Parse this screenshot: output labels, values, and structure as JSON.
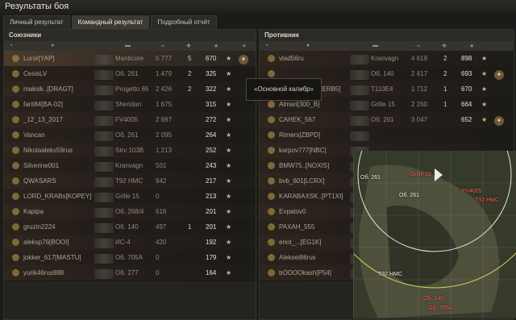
{
  "window": {
    "title": "Результаты боя"
  },
  "tabs": [
    {
      "label": "Личный результат",
      "active": false
    },
    {
      "label": "Командный результат",
      "active": true
    },
    {
      "label": "Подробный отчёт",
      "active": false
    }
  ],
  "allies": {
    "title": "Союзники",
    "rows": [
      {
        "player": "Luror[YAP]",
        "tank": "Manticore",
        "damage": "5 777",
        "kills": "5",
        "xp": "670"
      },
      {
        "player": "CesisLV",
        "tank": "Об. 261",
        "damage": "1 479",
        "kills": "2",
        "xp": "325"
      },
      {
        "player": "maksik..[DRAGT]",
        "tank": "Progetto 65",
        "damage": "2 426",
        "kills": "2",
        "xp": "322"
      },
      {
        "player": "farit84[BA-02]",
        "tank": "Sheridan",
        "damage": "1 675",
        "kills": "",
        "xp": "315"
      },
      {
        "player": "_12_13_2017",
        "tank": "FV4005",
        "damage": "2 697",
        "kills": "",
        "xp": "272"
      },
      {
        "player": "Vancan",
        "tank": "Об. 261",
        "damage": "2 095",
        "kills": "",
        "xp": "264"
      },
      {
        "player": "Nikolaaleks59rus",
        "tank": "Strv 103B",
        "damage": "1 213",
        "kills": "",
        "xp": "252"
      },
      {
        "player": "Silverine001",
        "tank": "Kranvagn",
        "damage": "501",
        "kills": "",
        "xp": "243"
      },
      {
        "player": "QWASARS",
        "tank": "T92 HMC",
        "damage": "942",
        "kills": "",
        "xp": "217"
      },
      {
        "player": "LORD_KRABs[KOPEY]",
        "tank": "Grille 15",
        "damage": "0",
        "kills": "",
        "xp": "213"
      },
      {
        "player": "Kapipa",
        "tank": "Об. 268/4",
        "damage": "616",
        "kills": "",
        "xp": "201"
      },
      {
        "player": "gruzin2224",
        "tank": "Об. 140",
        "damage": "497",
        "kills": "1",
        "xp": "201"
      },
      {
        "player": "aleksp76[BOOI]",
        "tank": "ИС-4",
        "damage": "420",
        "kills": "",
        "xp": "192"
      },
      {
        "player": "jokker_617[MASTU]",
        "tank": "Об. 705A",
        "damage": "0",
        "kills": "",
        "xp": "179"
      },
      {
        "player": "yurik46rus888",
        "tank": "Об. 277",
        "damage": "0",
        "kills": "",
        "xp": "164"
      }
    ]
  },
  "enemies": {
    "title": "Противник",
    "rows": [
      {
        "player": "vlad56ru",
        "tank": "Kranvagn",
        "damage": "4 619",
        "kills": "2",
        "xp": "898"
      },
      {
        "player": "",
        "tank": "Об. 140",
        "damage": "2 417",
        "kills": "2",
        "xp": "693"
      },
      {
        "player": "Gopnik_Myp[GERB5]",
        "tank": "T110E4",
        "damage": "1 712",
        "kills": "1",
        "xp": "670"
      },
      {
        "player": "Almari[300_B]",
        "tank": "Grille 15",
        "damage": "2 260",
        "kills": "1",
        "xp": "664"
      },
      {
        "player": "CAHEK_567",
        "tank": "Об. 261",
        "damage": "3 047",
        "kills": "",
        "xp": "652"
      },
      {
        "player": "Rimers[ZBPD]",
        "tank": "",
        "damage": "",
        "kills": "",
        "xp": ""
      },
      {
        "player": "karpov777[NBC]",
        "tank": "",
        "damage": "",
        "kills": "",
        "xp": ""
      },
      {
        "player": "BMW75..[NOXIS]",
        "tank": "",
        "damage": "",
        "kills": "",
        "xp": ""
      },
      {
        "player": "bvb_601[LCRX]",
        "tank": "",
        "damage": "",
        "kills": "",
        "xp": ""
      },
      {
        "player": "KARABAXSK..[PT1XI]",
        "tank": "",
        "damage": "",
        "kills": "",
        "xp": ""
      },
      {
        "player": "Evpatov0",
        "tank": "",
        "damage": "",
        "kills": "",
        "xp": ""
      },
      {
        "player": "PAXAH_555",
        "tank": "",
        "damage": "",
        "kills": "",
        "xp": ""
      },
      {
        "player": "enot_...[EG1K]",
        "tank": "",
        "damage": "",
        "kills": "",
        "xp": ""
      },
      {
        "player": "Aleksei86rus",
        "tank": "",
        "damage": "",
        "kills": "",
        "xp": ""
      },
      {
        "player": "bOOOOkash[P54]",
        "tank": "",
        "damage": "",
        "kills": "",
        "xp": ""
      }
    ]
  },
  "tooltip": {
    "text": "«Основной калибр»"
  },
  "minimap": {
    "labels": [
      {
        "text": "Об. 261",
        "color": "white"
      },
      {
        "text": "Об. 261",
        "color": "white"
      },
      {
        "text": "FV4005",
        "color": "red"
      },
      {
        "text": "T92 HMC",
        "color": "red"
      },
      {
        "text": "T92 HMC",
        "color": "white"
      },
      {
        "text": "Об. 140",
        "color": "red"
      },
      {
        "text": "Об. 705A",
        "color": "red"
      },
      {
        "text": "Grille 15",
        "color": "red"
      }
    ]
  }
}
